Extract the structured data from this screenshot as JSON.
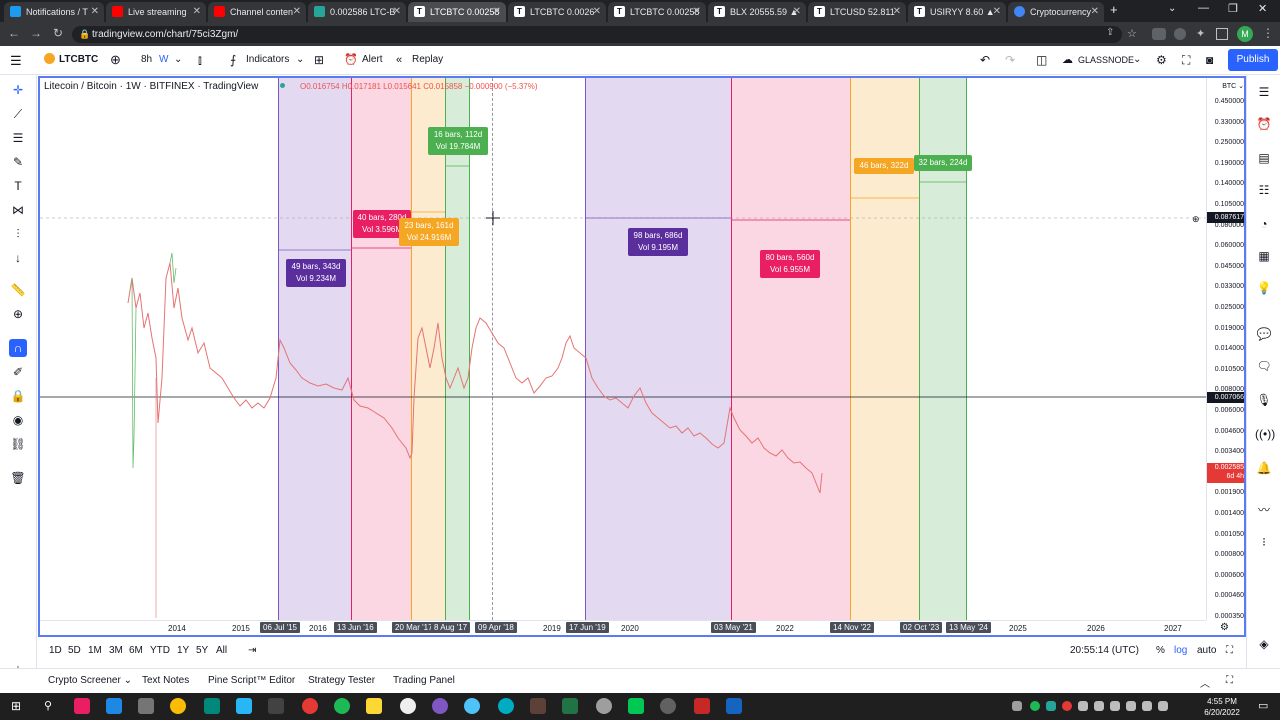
{
  "browser": {
    "tabs": [
      {
        "label": "Notifications / T",
        "icon_color": "#1d9bf0"
      },
      {
        "label": "Live streaming",
        "icon_color": "#ff0000"
      },
      {
        "label": "Channel conten",
        "icon_color": "#ff0000"
      },
      {
        "label": "0.002586 LTC-B",
        "icon_color": "#26a69a"
      },
      {
        "label": "LTCBTC 0.00258",
        "icon_color": "#131722"
      },
      {
        "label": "LTCBTC 0.0026",
        "icon_color": "#131722"
      },
      {
        "label": "LTCBTC 0.00258",
        "icon_color": "#131722"
      },
      {
        "label": "BLX 20555.59 ▲",
        "icon_color": "#131722"
      },
      {
        "label": "LTCUSD 52.811",
        "icon_color": "#131722"
      },
      {
        "label": "USIRYY 8.60 ▲",
        "icon_color": "#131722"
      },
      {
        "label": "Cryptocurrency",
        "icon_color": "#4285f4"
      }
    ],
    "url": "tradingview.com/chart/75ci3Zgm/",
    "new_tab": "+"
  },
  "toolbar": {
    "symbol": "LTCBTC",
    "interval_a": "8h",
    "interval_b": "W",
    "indicators": "Indicators",
    "alert": "Alert",
    "replay": "Replay",
    "layout_name": "GLASSNODE",
    "publish": "Publish"
  },
  "chart": {
    "legend_title": "Litecoin / Bitcoin · 1W · BITFINEX · TradingView",
    "ohlc": "O0.016754 H0.017181 L0.015641 C0.015858 −0.000900 (−5.37%)",
    "currency": "BTC",
    "price_labels": [
      "0.450000",
      "0.330000",
      "0.250000",
      "0.190000",
      "0.140000",
      "0.105000",
      "0.080000",
      "0.060000",
      "0.045000",
      "0.033000",
      "0.025000",
      "0.019000",
      "0.014000",
      "0.010500",
      "0.008000",
      "0.006000",
      "0.004600",
      "0.003400",
      "0.002600",
      "0.001900",
      "0.001400",
      "0.001050",
      "0.000800",
      "0.000600",
      "0.000460",
      "0.000350"
    ],
    "crosshair_price": "0.087617",
    "hline_price": "0.007066",
    "last_price": "0.002585",
    "last_price_countdown": "6d 4h",
    "time_labels": [
      "2014",
      "2015",
      "2016",
      "2019",
      "2020",
      "2022",
      "2025",
      "2026",
      "2027"
    ],
    "time_markers": [
      "06 Jul '15",
      "13 Jun '16",
      "20 Mar '17",
      "8 Aug '17",
      "09 Apr '18",
      "17 Jun '19",
      "03 May '21",
      "14 Nov '22",
      "02 Oct '23",
      "13 May '24"
    ],
    "ranges": [
      {
        "bars": "49 bars, 343d",
        "vol": "Vol 9.234M",
        "color": "#5b2e9e"
      },
      {
        "bars": "40 bars, 280d",
        "vol": "Vol 3.596M",
        "color": "#e91e63"
      },
      {
        "bars": "23 bars, 161d",
        "vol": "Vol 24.916M",
        "color": "#f5a623"
      },
      {
        "bars": "16 bars, 112d",
        "vol": "Vol 19.784M",
        "color": "#4caf50"
      },
      {
        "bars": "98 bars, 686d",
        "vol": "Vol 9.195M",
        "color": "#5b2e9e"
      },
      {
        "bars": "80 bars, 560d",
        "vol": "Vol 6.955M",
        "color": "#e91e63"
      },
      {
        "bars": "46 bars, 322d",
        "vol": "",
        "color": "#f5a623"
      },
      {
        "bars": "32 bars, 224d",
        "vol": "",
        "color": "#4caf50"
      }
    ]
  },
  "range_buttons": [
    "1D",
    "5D",
    "1M",
    "3M",
    "6M",
    "YTD",
    "1Y",
    "5Y",
    "All"
  ],
  "clock": "20:55:14 (UTC)",
  "scale": {
    "percent": "%",
    "log": "log",
    "auto": "auto"
  },
  "panels": [
    "Crypto Screener",
    "Text Notes",
    "Pine Script™ Editor",
    "Strategy Tester",
    "Trading Panel"
  ],
  "taskbar": {
    "time": "4:55 PM",
    "date": "6/20/2022"
  }
}
